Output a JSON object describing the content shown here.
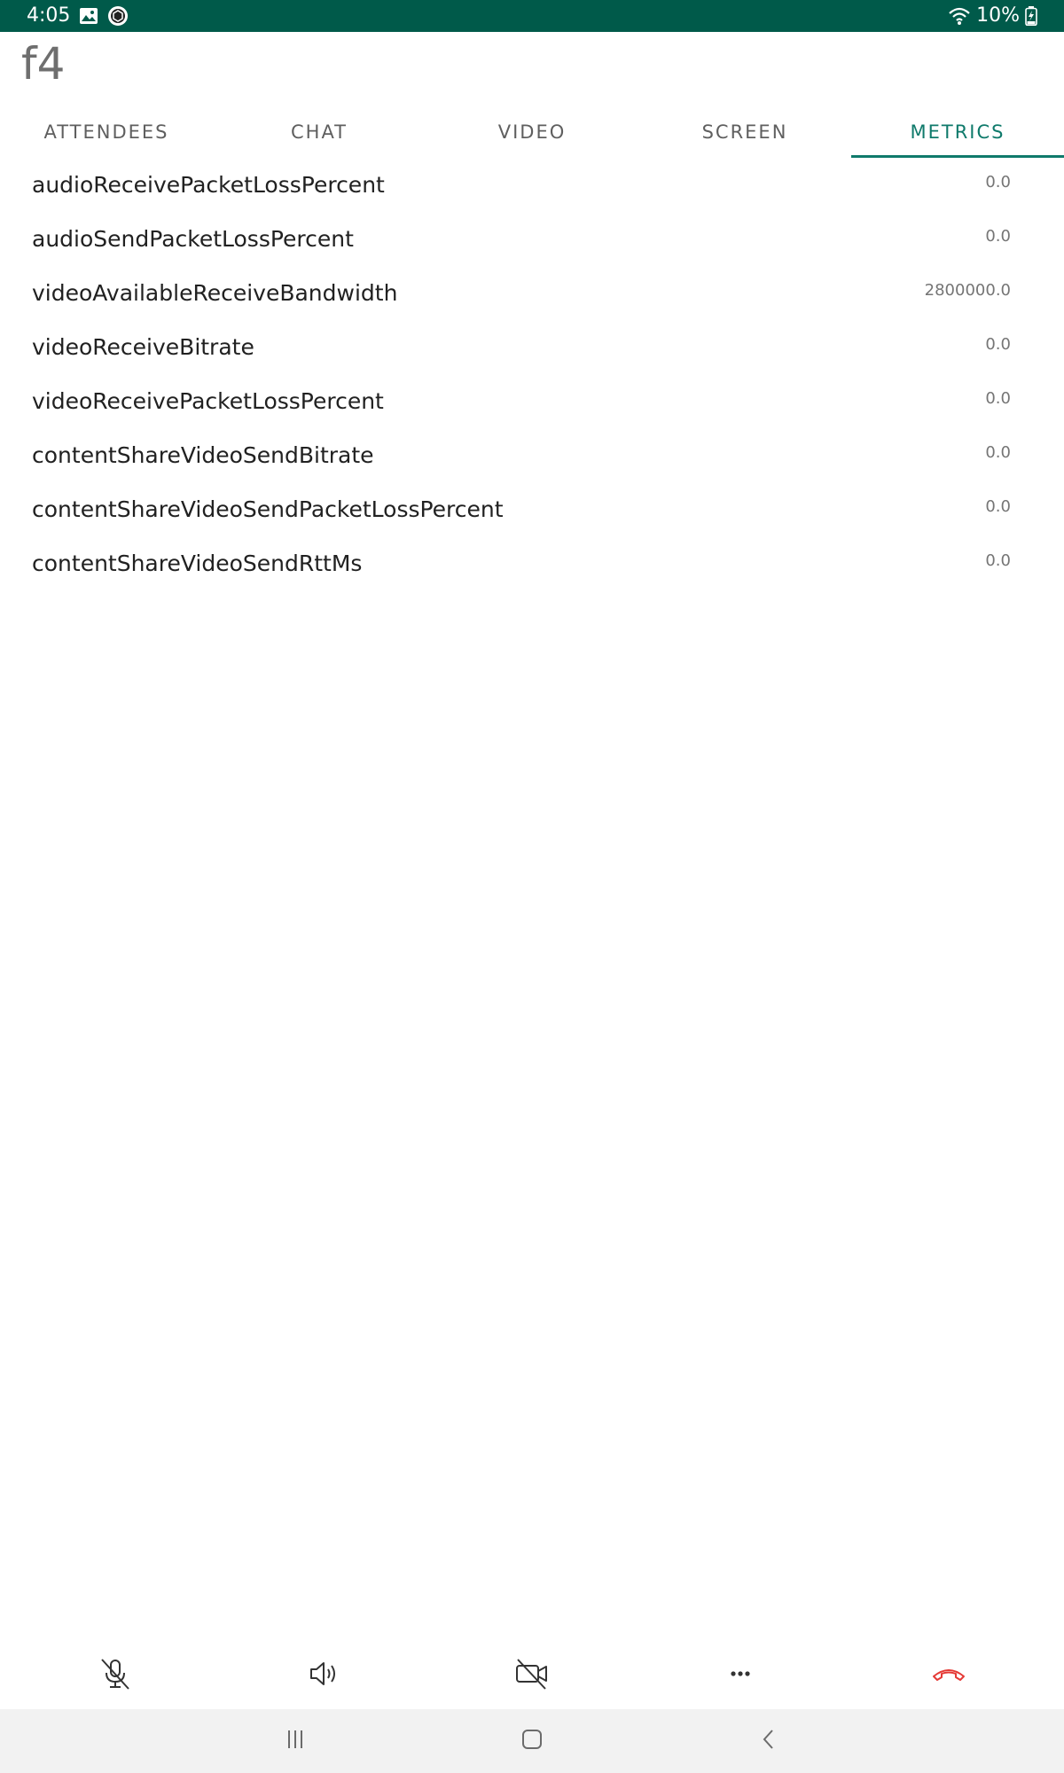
{
  "status_bar": {
    "time": "4:05",
    "battery": "10%"
  },
  "app": {
    "title": "f4"
  },
  "tabs": [
    {
      "label": "ATTENDEES"
    },
    {
      "label": "CHAT"
    },
    {
      "label": "VIDEO"
    },
    {
      "label": "SCREEN"
    },
    {
      "label": "METRICS",
      "active": true
    }
  ],
  "metrics": [
    {
      "name": "audioReceivePacketLossPercent",
      "value": "0.0"
    },
    {
      "name": "audioSendPacketLossPercent",
      "value": "0.0"
    },
    {
      "name": "videoAvailableReceiveBandwidth",
      "value": "2800000.0"
    },
    {
      "name": "videoReceiveBitrate",
      "value": "0.0"
    },
    {
      "name": "videoReceivePacketLossPercent",
      "value": "0.0"
    },
    {
      "name": "contentShareVideoSendBitrate",
      "value": "0.0"
    },
    {
      "name": "contentShareVideoSendPacketLossPercent",
      "value": "0.0"
    },
    {
      "name": "contentShareVideoSendRttMs",
      "value": "0.0"
    }
  ],
  "controls": [
    {
      "icon": "mic-off-icon"
    },
    {
      "icon": "speaker-icon"
    },
    {
      "icon": "video-off-icon"
    },
    {
      "icon": "more-icon"
    },
    {
      "icon": "end-call-icon"
    }
  ],
  "colors": {
    "status_bar": "#005a4a",
    "accent": "#0f7a6b",
    "end_call": "#e53935"
  }
}
